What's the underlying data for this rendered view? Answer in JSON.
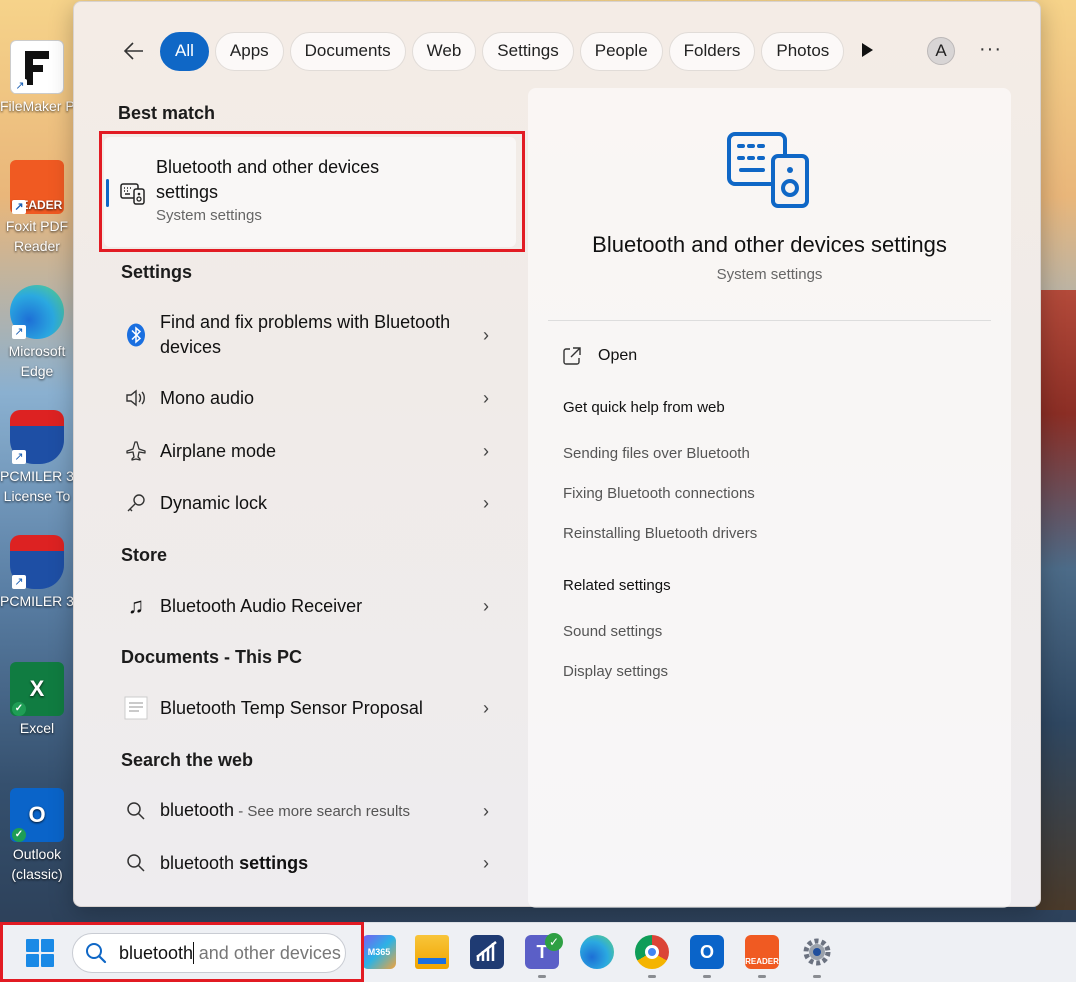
{
  "desktop": {
    "icons": [
      {
        "label": "FileMaker P",
        "icon": "filemaker-icon",
        "badge": "shortcut"
      },
      {
        "label": "Foxit PDF Reader",
        "icon": "foxit-reader-icon",
        "badge": "shortcut"
      },
      {
        "label": "Microsoft Edge",
        "icon": "edge-icon",
        "badge": "shortcut"
      },
      {
        "label": "PCMILER 3 License To",
        "icon": "pcmiler-license-icon",
        "badge": "shortcut"
      },
      {
        "label": "PCMILER 3",
        "icon": "pcmiler-icon",
        "badge": "shortcut"
      },
      {
        "label": "Excel",
        "icon": "excel-icon",
        "badge": "synced"
      },
      {
        "label": "Outlook (classic)",
        "icon": "outlook-icon",
        "badge": "synced"
      }
    ]
  },
  "search_panel": {
    "back_icon": "back-arrow-icon",
    "filters": [
      "All",
      "Apps",
      "Documents",
      "Web",
      "Settings",
      "People",
      "Folders",
      "Photos"
    ],
    "active_filter": "All",
    "avatar_initial": "A",
    "more_label": "···",
    "sections": {
      "best_match": "Best match",
      "settings": "Settings",
      "store": "Store",
      "documents": "Documents - This PC",
      "web": "Search the web"
    },
    "best_match": {
      "title": "Bluetooth and other devices settings",
      "subtitle": "System settings",
      "icon": "devices-icon"
    },
    "settings_results": [
      {
        "label": "Find and fix problems with Bluetooth devices",
        "icon": "bluetooth-icon"
      },
      {
        "label": "Mono audio",
        "icon": "speaker-icon"
      },
      {
        "label": "Airplane mode",
        "icon": "airplane-icon"
      },
      {
        "label": "Dynamic lock",
        "icon": "key-icon"
      }
    ],
    "store_results": [
      {
        "label": "Bluetooth Audio Receiver",
        "icon": "music-note-icon"
      }
    ],
    "document_results": [
      {
        "label": "Bluetooth Temp Sensor Proposal",
        "icon": "document-icon"
      }
    ],
    "web_results": [
      {
        "query": "bluetooth",
        "suffix": " - See more search results",
        "icon": "search-icon"
      },
      {
        "prefix": "bluetooth ",
        "bold": "settings",
        "icon": "search-icon"
      }
    ],
    "detail": {
      "title": "Bluetooth and other devices settings",
      "subtitle": "System settings",
      "open_label": "Open",
      "quick_help_heading": "Get quick help from web",
      "quick_help_links": [
        "Sending files over Bluetooth",
        "Fixing Bluetooth connections",
        "Reinstalling Bluetooth drivers"
      ],
      "related_heading": "Related settings",
      "related_links": [
        "Sound settings",
        "Display settings"
      ]
    }
  },
  "taskbar": {
    "search_typed": "bluetooth",
    "search_suggestion": " and other devices settings",
    "apps": [
      {
        "name": "Microsoft 365 Copilot",
        "icon": "m365-icon",
        "label": "M365"
      },
      {
        "name": "File Explorer",
        "icon": "folder-icon"
      },
      {
        "name": "Chart app",
        "icon": "chart-app-icon"
      },
      {
        "name": "Teams",
        "icon": "teams-icon",
        "label": "T"
      },
      {
        "name": "Edge",
        "icon": "edge-icon"
      },
      {
        "name": "Chrome",
        "icon": "chrome-icon"
      },
      {
        "name": "Outlook",
        "icon": "outlook-icon",
        "label": "O"
      },
      {
        "name": "Foxit Reader",
        "icon": "foxit-reader-icon",
        "label": "READER"
      },
      {
        "name": "Settings",
        "icon": "gear-icon"
      }
    ]
  },
  "colors": {
    "accent": "#0f67c6",
    "highlight_box": "#e21b23"
  }
}
